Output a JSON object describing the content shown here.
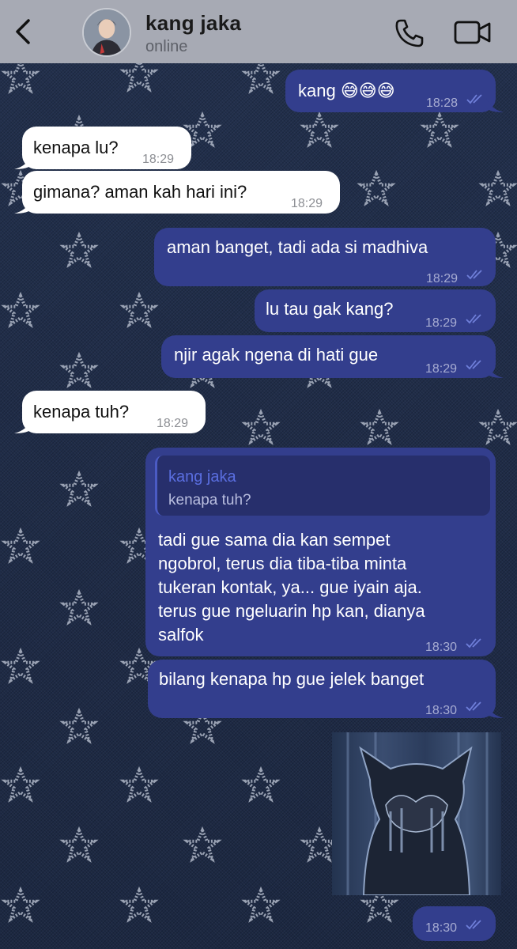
{
  "header": {
    "contact_name": "kang jaka",
    "status": "online"
  },
  "messages": [
    {
      "text": "kang 😅😅😅",
      "time": "18:28"
    },
    {
      "text": "kenapa lu?",
      "time": "18:29"
    },
    {
      "text": "gimana? aman kah hari ini?",
      "time": "18:29"
    },
    {
      "text": "aman banget, tadi ada si madhiva",
      "time": "18:29"
    },
    {
      "text": "lu tau gak kang?",
      "time": "18:29"
    },
    {
      "text": "njir agak ngena di hati gue",
      "time": "18:29"
    },
    {
      "text": "kenapa tuh?",
      "time": "18:29"
    },
    {
      "reply_name": "kang jaka",
      "reply_text": "kenapa tuh?",
      "lines": [
        "tadi gue sama dia kan sempet",
        "ngobrol, terus dia tiba-tiba minta",
        "tukeran kontak, ya... gue iyain aja.",
        "terus gue ngeluarin hp kan, dianya",
        "salfok"
      ],
      "time": "18:30"
    },
    {
      "text": "bilang kenapa hp gue jelek banget",
      "time": "18:30"
    },
    {
      "time": "18:30"
    }
  ],
  "icons": {
    "back": "chevron-left-icon",
    "call": "phone-icon",
    "video": "video-camera-icon",
    "read": "double-check-icon"
  },
  "colors": {
    "header_bg": "#a7aab4",
    "outgoing_bubble": "#333e8d",
    "incoming_bubble": "#ffffff",
    "read_ticks": "#6f7fd9"
  }
}
